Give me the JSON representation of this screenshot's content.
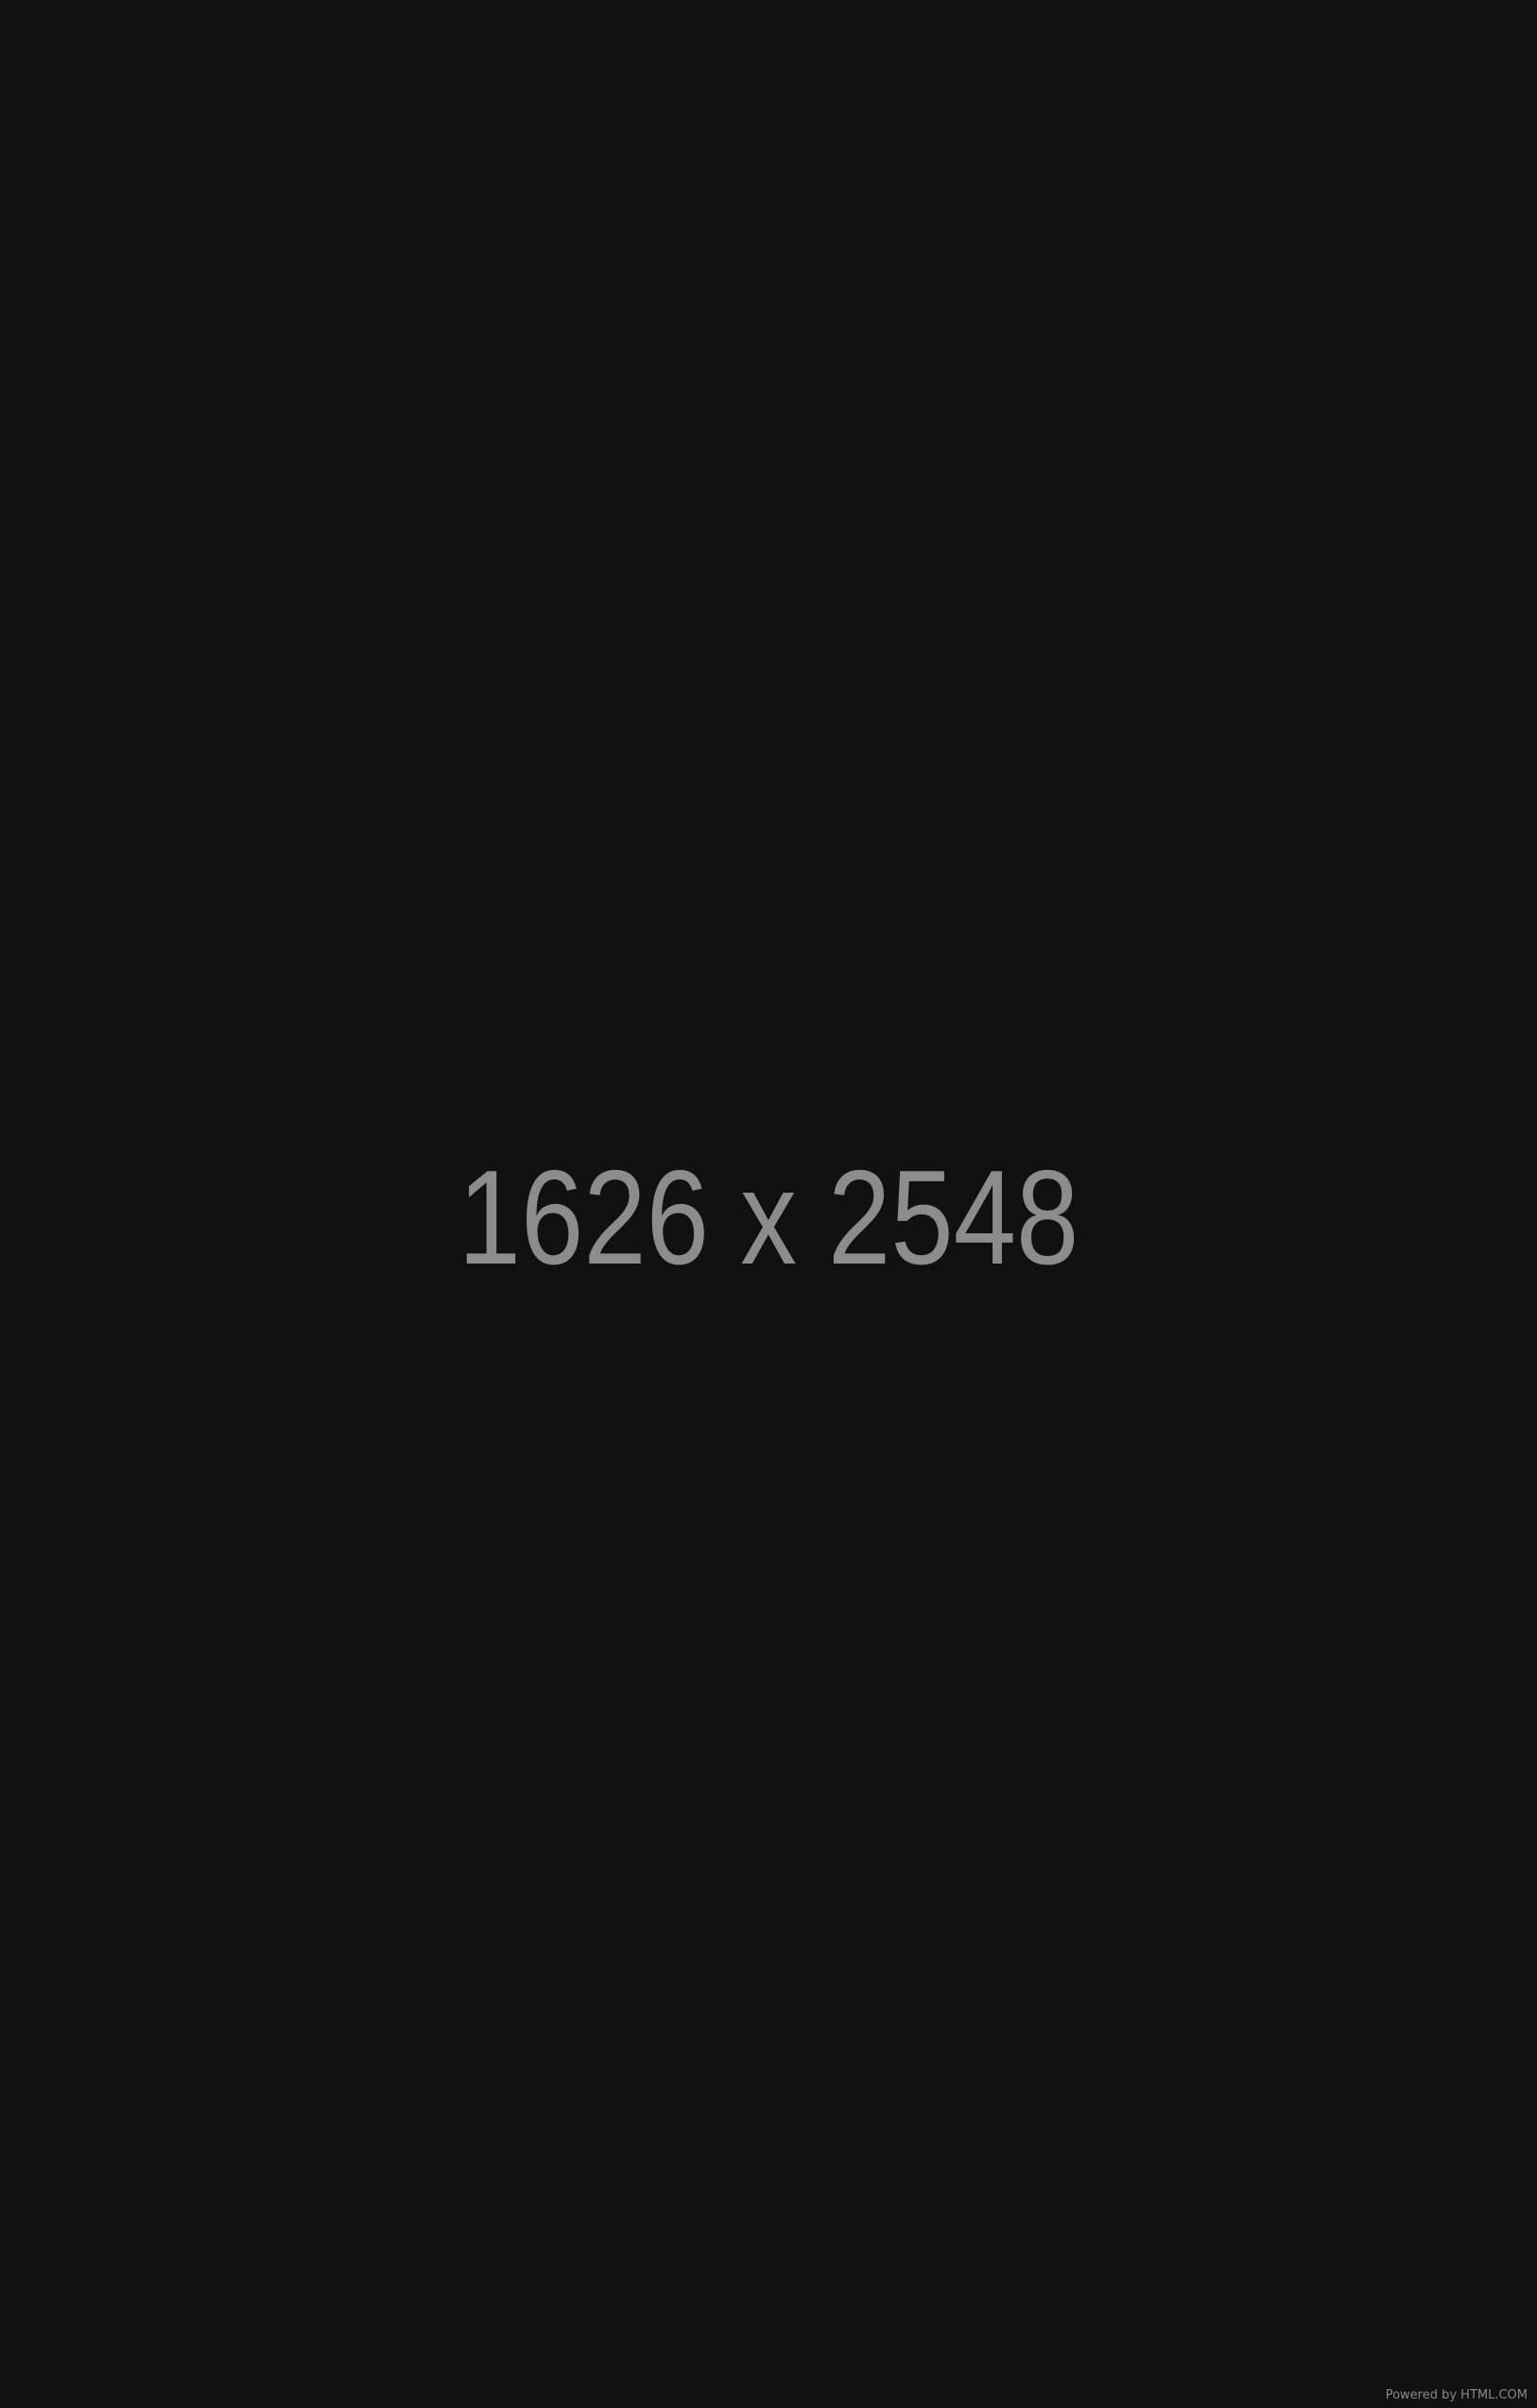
{
  "placeholder": {
    "dimensions_text": "1626 x 2548",
    "footer_text": "Powered by HTML.COM"
  },
  "colors": {
    "background": "#111111",
    "text": "#8c8c8c"
  }
}
